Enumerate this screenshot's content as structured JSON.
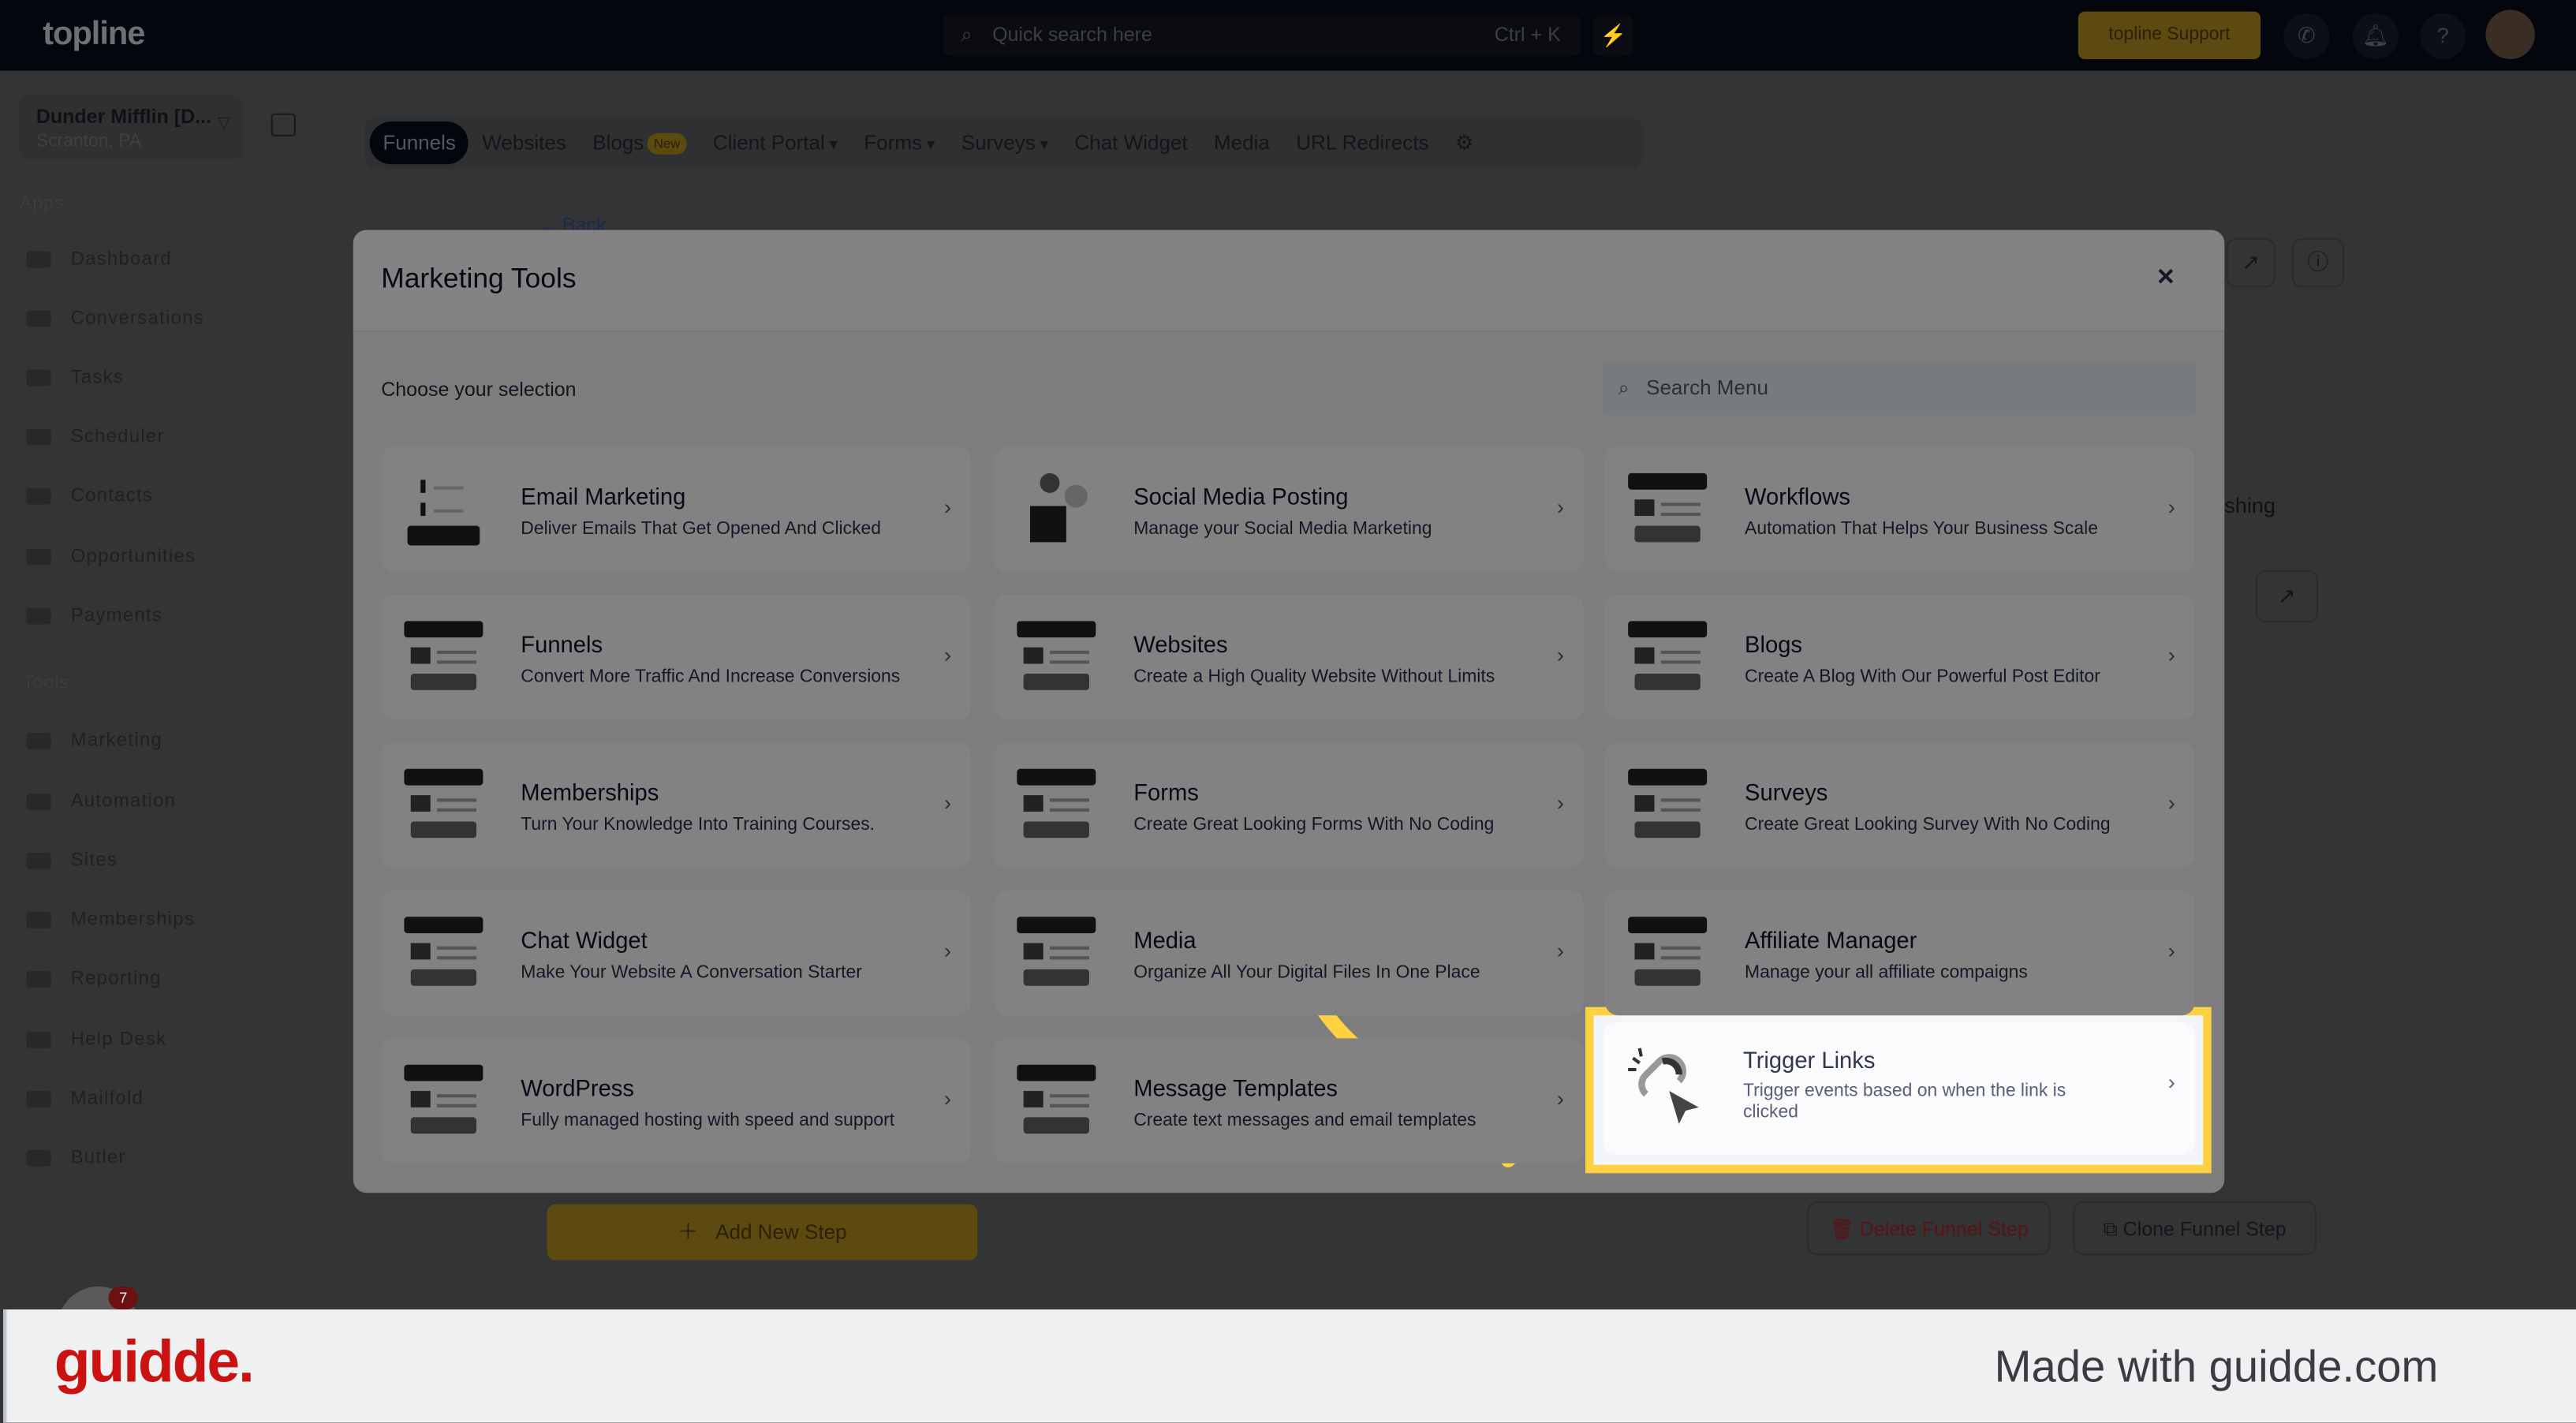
{
  "topbar": {
    "logo": "topline",
    "search_placeholder": "Quick search here",
    "search_shortcut": "Ctrl + K",
    "support_label": "topline Support"
  },
  "account": {
    "name": "Dunder Mifflin [D...",
    "location": "Scranton, PA"
  },
  "sidebar": {
    "apps_label": "Apps",
    "apps": [
      "Dashboard",
      "Conversations",
      "Tasks",
      "Scheduler",
      "Contacts",
      "Opportunities",
      "Payments"
    ],
    "tools_label": "Tools",
    "tools": [
      "Marketing",
      "Automation",
      "Sites",
      "Memberships",
      "Reporting",
      "Help Desk",
      "Mailfold",
      "Butler"
    ]
  },
  "tabs": [
    {
      "label": "Funnels",
      "active": true
    },
    {
      "label": "Websites"
    },
    {
      "label": "Blogs",
      "badge": "New"
    },
    {
      "label": "Client Portal",
      "dropdown": true
    },
    {
      "label": "Forms",
      "dropdown": true
    },
    {
      "label": "Surveys",
      "dropdown": true
    },
    {
      "label": "Chat Widget"
    },
    {
      "label": "Media"
    },
    {
      "label": "URL Redirects"
    }
  ],
  "background": {
    "back_label": "← Back",
    "partial_text": "shing",
    "add_step_label": "Add New Step",
    "delete_step_label": "Delete Funnel Step",
    "clone_step_label": "Clone Funnel Step",
    "notification_count": "7"
  },
  "modal": {
    "title": "Marketing Tools",
    "close_label": "×",
    "subtitle": "Choose your selection",
    "search_placeholder": "Search Menu",
    "cards": [
      {
        "title": "Email Marketing",
        "desc": "Deliver Emails That Get Opened And Clicked",
        "icon": "email-icon"
      },
      {
        "title": "Social Media Posting",
        "desc": "Manage your Social Media Marketing",
        "icon": "social-icon"
      },
      {
        "title": "Workflows",
        "desc": "Automation That Helps Your Business Scale",
        "icon": "workflow-icon"
      },
      {
        "title": "Funnels",
        "desc": "Convert More Traffic And Increase Conversions",
        "icon": "funnel-icon"
      },
      {
        "title": "Websites",
        "desc": "Create a High Quality Website Without Limits",
        "icon": "website-icon"
      },
      {
        "title": "Blogs",
        "desc": "Create A Blog With Our Powerful Post Editor",
        "icon": "blog-icon"
      },
      {
        "title": "Memberships",
        "desc": "Turn Your Knowledge Into Training Courses.",
        "icon": "membership-icon"
      },
      {
        "title": "Forms",
        "desc": "Create Great Looking Forms With No Coding",
        "icon": "form-icon"
      },
      {
        "title": "Surveys",
        "desc": "Create Great Looking Survey With No Coding",
        "icon": "survey-icon"
      },
      {
        "title": "Chat Widget",
        "desc": "Make Your Website A Conversation Starter",
        "icon": "chat-icon"
      },
      {
        "title": "Media",
        "desc": "Organize All Your Digital Files In One Place",
        "icon": "media-icon"
      },
      {
        "title": "Affiliate Manager",
        "desc": "Manage your all affiliate compaigns",
        "icon": "affiliate-icon"
      },
      {
        "title": "WordPress",
        "desc": "Fully managed hosting with speed and support",
        "icon": "wordpress-icon"
      },
      {
        "title": "Message Templates",
        "desc": "Create text messages and email templates",
        "icon": "template-icon"
      },
      {
        "title": "Trigger Links",
        "desc": "Trigger events based on when the link is clicked",
        "icon": "trigger-link-icon",
        "highlighted": true
      }
    ]
  },
  "footer": {
    "logo": "guidde.",
    "made_with": "Made with guidde.com"
  },
  "colors": {
    "highlight": "#fdd13f",
    "guidde_red": "#cc1111",
    "topbar": "#03060c"
  }
}
